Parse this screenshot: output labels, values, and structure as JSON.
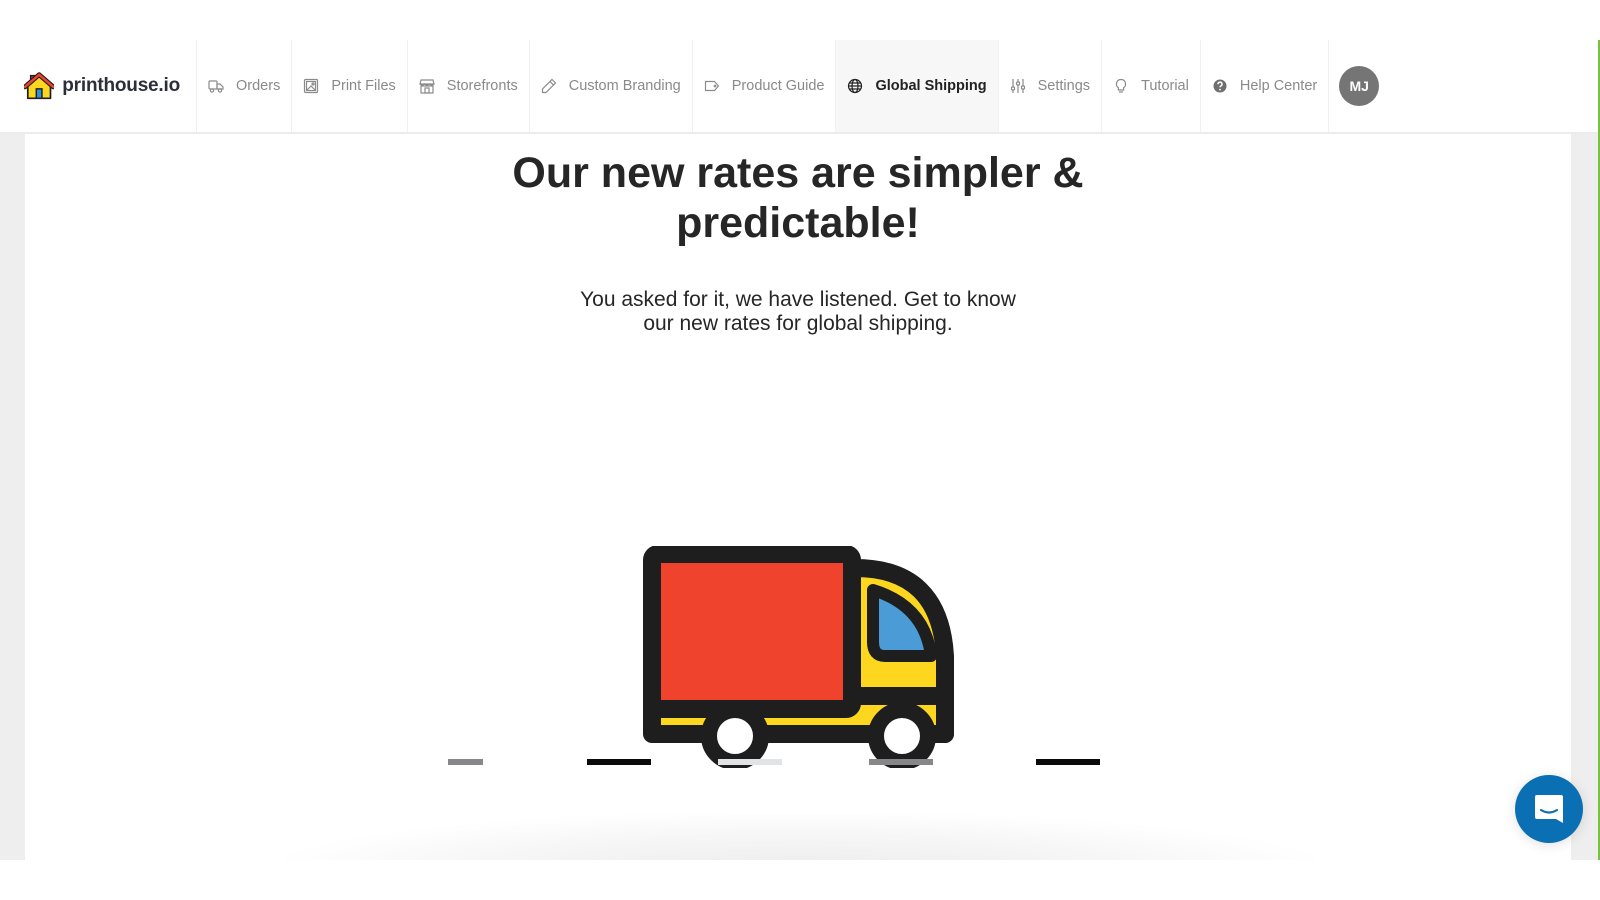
{
  "brand": {
    "name": "printhouse.io",
    "logo_icon": "house-icon"
  },
  "nav": {
    "items": [
      {
        "label": "Orders",
        "icon": "truck-icon",
        "active": false
      },
      {
        "label": "Print Files",
        "icon": "image-icon",
        "active": false
      },
      {
        "label": "Storefronts",
        "icon": "store-icon",
        "active": false
      },
      {
        "label": "Custom Branding",
        "icon": "pencil-icon",
        "active": false
      },
      {
        "label": "Product Guide",
        "icon": "tag-icon",
        "active": false
      },
      {
        "label": "Global Shipping",
        "icon": "globe-icon",
        "active": true
      },
      {
        "label": "Settings",
        "icon": "sliders-icon",
        "active": false
      },
      {
        "label": "Tutorial",
        "icon": "lightbulb-icon",
        "active": false
      },
      {
        "label": "Help Center",
        "icon": "question-circle-icon",
        "active": false
      }
    ],
    "avatar_initials": "MJ"
  },
  "hero": {
    "headline_line1": "Our new rates are simpler &",
    "headline_line2": "predictable!",
    "subtitle_line1": "You asked for it, we have listened. Get to know",
    "subtitle_line2": "our new rates for global shipping."
  },
  "illustration": {
    "name": "delivery-truck",
    "colors": {
      "outline": "#1e1e1e",
      "cargo": "#ef432e",
      "cab": "#fdd61f",
      "window": "#4a9bd6",
      "wheel_hub": "#ffffff"
    }
  },
  "chat": {
    "icon": "chat-bubble-icon",
    "color": "#0b6fb3"
  },
  "colors": {
    "accent_green": "#7ac143",
    "active_nav_bg": "#f7f7f7",
    "page_bg": "#eeeeee"
  }
}
